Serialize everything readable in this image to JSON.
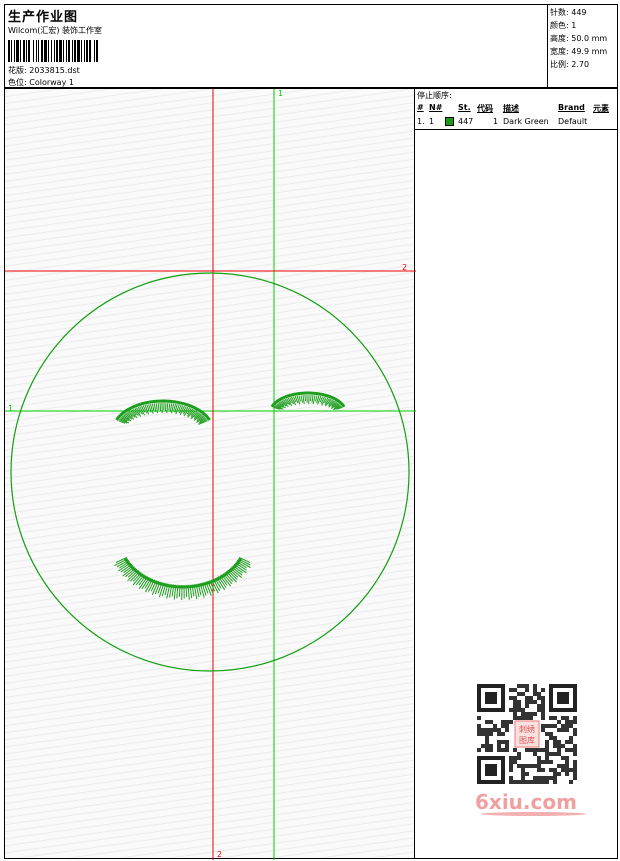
{
  "header": {
    "title": "生产作业图",
    "company": "Wilcom(汇宏) 装饰工作室",
    "design_label": "花版:",
    "design_value": "2033815.dst",
    "colorway_label": "色位:",
    "colorway_value": "Colorway 1"
  },
  "stats": {
    "stitches": "针数: 449",
    "colors": "颜色: 1",
    "height": "高度: 50.0 mm",
    "width": "宽度: 49.9 mm",
    "scale": "比例: 2.70"
  },
  "stop_sequence": {
    "title": "停止顺序:",
    "columns": [
      "#",
      "N#",
      "St.",
      "代码",
      "描述",
      "Brand",
      "元素"
    ],
    "rows": [
      {
        "num": "1.",
        "needle": "1",
        "stitches": "447",
        "code": "1",
        "description": "Dark Green",
        "brand": "Default",
        "color": "#1a9a1a"
      }
    ]
  },
  "guides": {
    "green_vertical_label": "1",
    "green_horizontal_label": "1",
    "red_horizontal_label": "2",
    "red_vertical_label": "2",
    "green_color": "#00cc00",
    "red_color": "#ee0000"
  },
  "embroidery": {
    "thread_color": "#1e9e1e",
    "outline_color": "#12a012"
  },
  "watermark": {
    "text": "6xiu.com",
    "qr_center_text_1": "刺绣",
    "qr_center_text_2": "图库"
  }
}
